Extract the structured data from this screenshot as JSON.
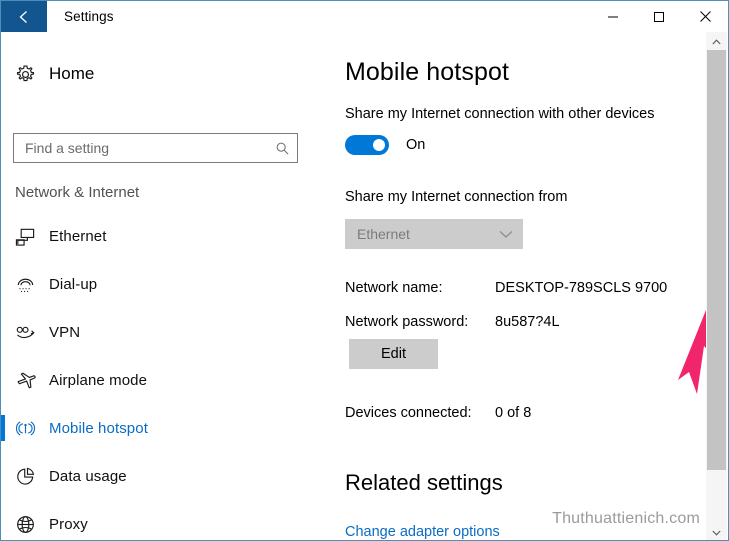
{
  "window": {
    "title": "Settings",
    "back_icon": "back-arrow-icon",
    "minimize_label": "Minimize",
    "maximize_label": "Maximize",
    "close_label": "Close"
  },
  "sidebar": {
    "home": {
      "label": "Home",
      "icon": "gear-icon"
    },
    "search": {
      "placeholder": "Find a setting",
      "value": "",
      "icon": "search-icon"
    },
    "category": "Network & Internet",
    "items": [
      {
        "label": "Ethernet",
        "icon": "ethernet-icon",
        "selected": false
      },
      {
        "label": "Dial-up",
        "icon": "dialup-icon",
        "selected": false
      },
      {
        "label": "VPN",
        "icon": "vpn-icon",
        "selected": false
      },
      {
        "label": "Airplane mode",
        "icon": "airplane-icon",
        "selected": false
      },
      {
        "label": "Mobile hotspot",
        "icon": "hotspot-icon",
        "selected": true
      },
      {
        "label": "Data usage",
        "icon": "pie-chart-icon",
        "selected": false
      },
      {
        "label": "Proxy",
        "icon": "globe-icon",
        "selected": false
      }
    ]
  },
  "main": {
    "heading": "Mobile hotspot",
    "share_label": "Share my Internet connection with other devices",
    "toggle_state": "On",
    "share_from_label": "Share my Internet connection from",
    "source_value": "Ethernet",
    "source_chevron": "chevron-down-icon",
    "network_name_key": "Network name:",
    "network_name_value": "DESKTOP-789SCLS 9700",
    "network_password_key": "Network password:",
    "network_password_value": "8u587?4L",
    "edit_label": "Edit",
    "devices_key": "Devices connected:",
    "devices_value": "0 of 8",
    "related_heading": "Related settings",
    "adapter_link": "Change adapter options"
  },
  "watermark": "Thuthuattienich.com",
  "scrollbar": {
    "up_icon": "chevron-up-icon",
    "down_icon": "chevron-down-icon"
  },
  "annotation": {
    "type": "arrow-pointing-down-at-edit-button",
    "color": "#f0256b"
  },
  "colors": {
    "accent": "#0078d7",
    "titlebar_back": "#12558f",
    "link": "#0a6cc4",
    "disabled_control": "#cccccc",
    "window_border": "#4a90b8"
  }
}
